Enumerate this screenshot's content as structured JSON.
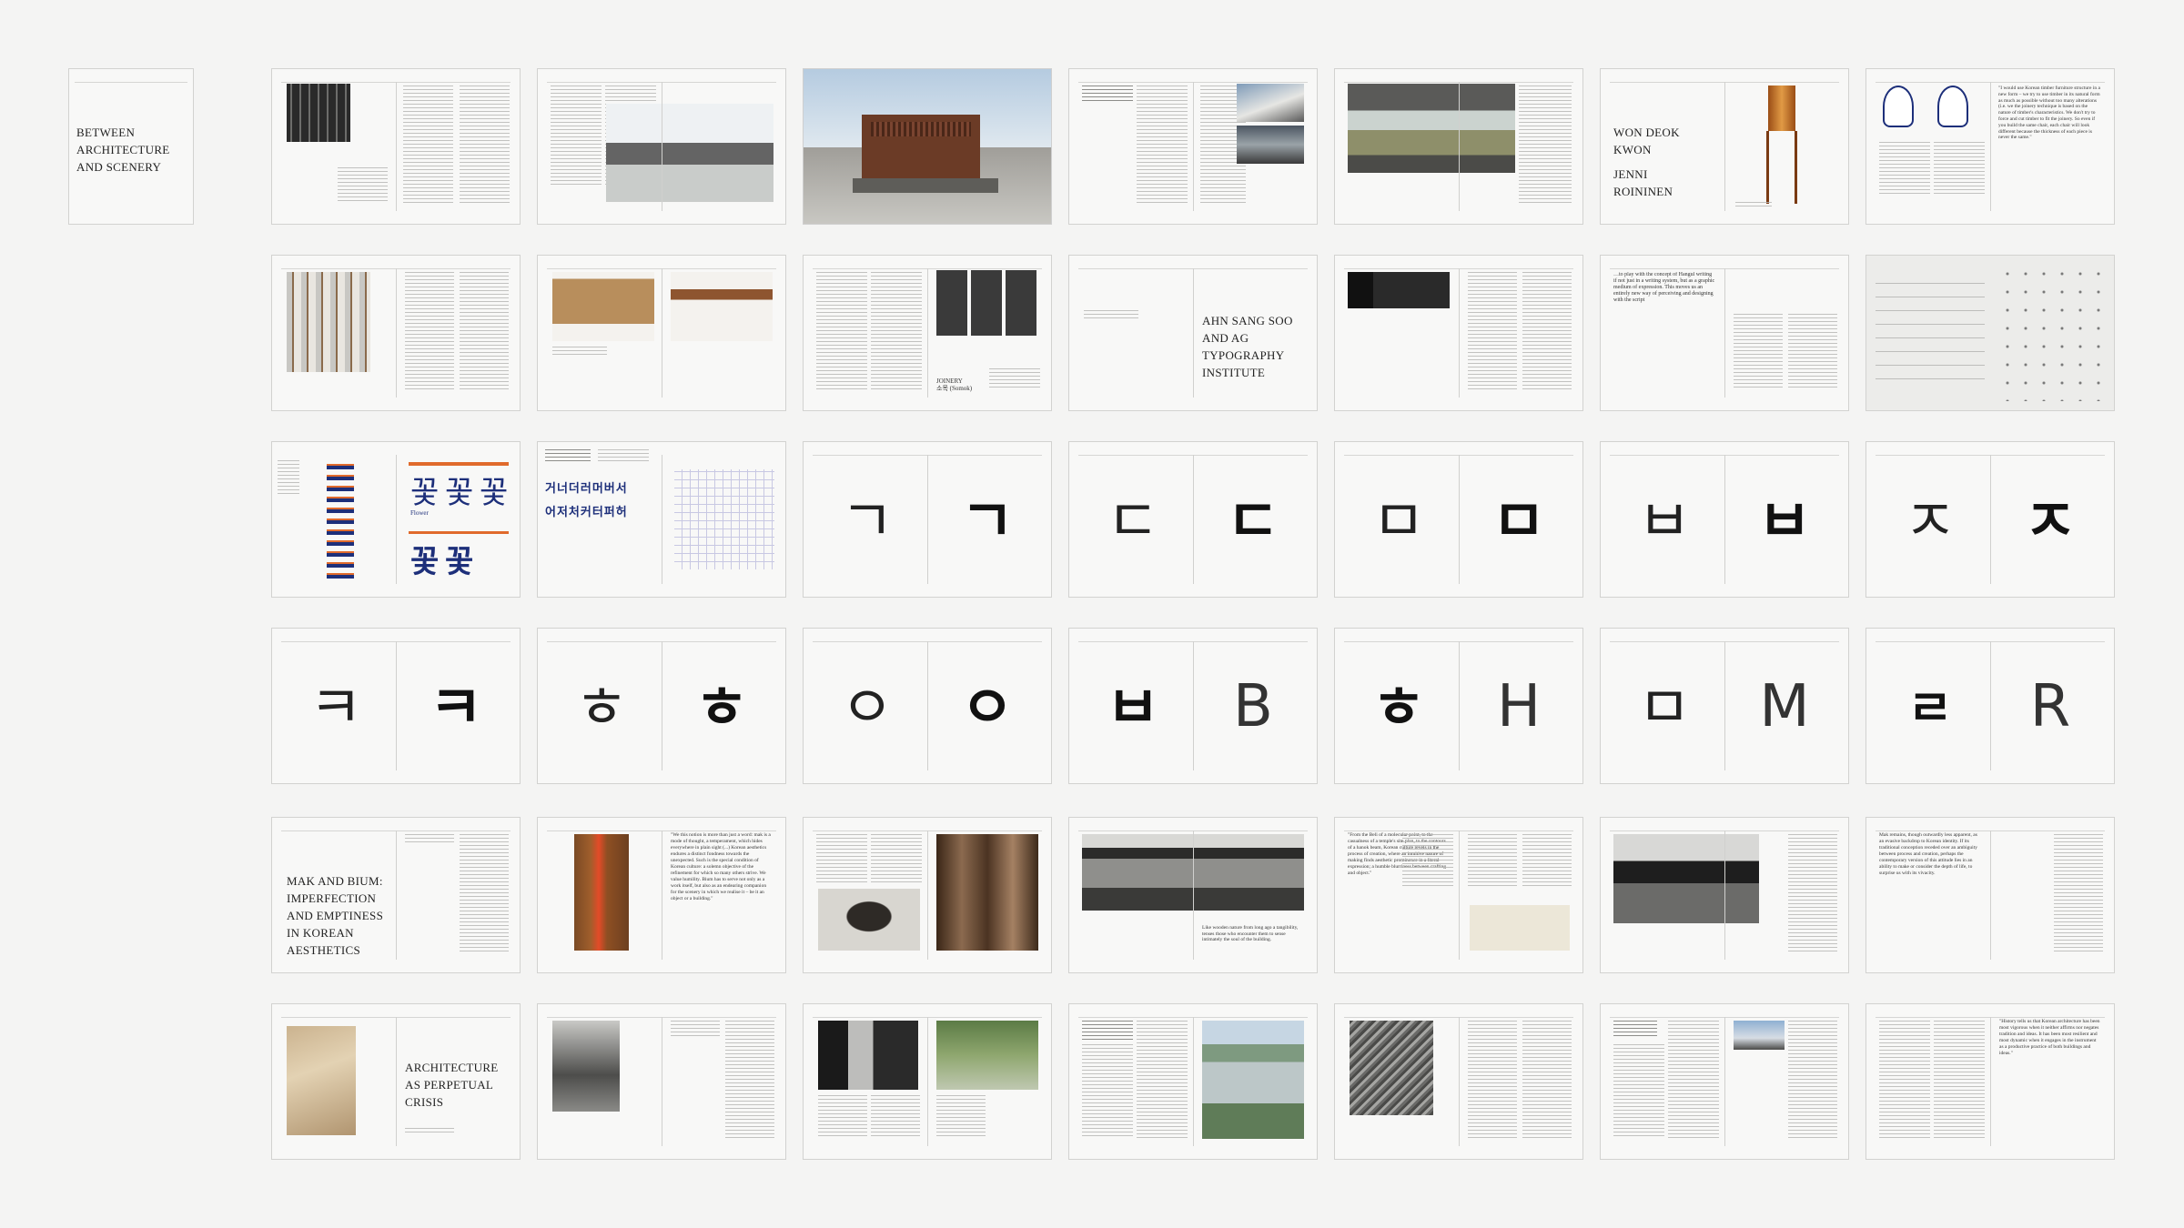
{
  "cover": {
    "title_lines": [
      "BETWEEN",
      "ARCHITECTURE",
      "AND SCENERY"
    ]
  },
  "spreads": {
    "won_deok": {
      "lines": [
        "WON DEOK",
        "KWON",
        "JENNI",
        "ROININEN"
      ]
    },
    "ahn_sang_soo": {
      "lines": [
        "AHN SANG SOO",
        "AND AG",
        "TYPOGRAPHY",
        "INSTITUTE"
      ]
    },
    "joinery": {
      "lines": [
        "JOINERY",
        "소목 (Somok)"
      ]
    },
    "mak_bium": {
      "lines": [
        "MAK AND BIUM:",
        "IMPERFECTION",
        "AND EMPTINESS",
        "IN KOREAN",
        "AESTHETICS"
      ]
    },
    "perpetual_crisis": {
      "lines": [
        "ARCHITECTURE",
        "AS PERPETUAL",
        "CRISIS"
      ]
    },
    "quote_lumber": {
      "text": "\"I would use Korean timber furniture structure in a new form – we try to use timber in its natural form as much as possible without too many alterations (i.e. we the joinery technique is based on the nature of timber's characteristics. We don't try to force and cut timber to fit the joinery. So even if you build the same chair, each chair will look different because the thickness of each piece is never the same.\""
    },
    "quote_hangul": {
      "text": "…to play with the concept of Hangul writing if not just in a writing system, but as a graphic medium of expression. This moves us an entirely new way of perceiving and designing with the script"
    },
    "quote_mak": {
      "text": "\"We this notion is more than just a word: mak is a mode of thought, a temperament, which hides everywhere in plain sight (...) Korean aesthetics endures a distinct fondness towards the unexpected. Such is the special condition of Korean culture: a solemn objective of the refinement for which so many others strive. We value humility. Bium has to serve not only as a work itself, but also as an endearing companion for the scenery in which we realise it – be it an object or a building.\""
    },
    "quote_nature": {
      "text": "Like wooden nature from long ago a tangibility, tenses those who encounter them to sense intimately the soul of the building."
    },
    "quote_molecular": {
      "text": "\"From the Beli of a molecular point, to the casualness of a temple's site plan, to the contours of a hanok beam, Korean culture revels in the process of creation, where an intuitive nature of making finds aesthetic prominence in a literal expression; a humble blurriness between crafting and object.\""
    },
    "quote_mak2": {
      "text": "Mak remains, though outwardly less apparent, as an evasive backdrop to Korean identity. If its traditional conception receded over an ambiguity between process and creation, perhaps the contemporary version of this attitude lies in an ability to make or consider the depth of life, to surprise us with its vivacity."
    },
    "quote_history": {
      "text": "\"History tells us that Korean architecture has been most vigorous when it neither affirms nor negates tradition and ideas. It has been most resilient and most dynamic when it engages in the instrument as a productive practice of both buildings and ideas.\""
    }
  },
  "glyph_pairs": [
    {
      "light": "ㄱ",
      "bold": "ㄱ"
    },
    {
      "light": "ㄷ",
      "bold": "ㄷ"
    },
    {
      "light": "ㅁ",
      "bold": "ㅁ"
    },
    {
      "light": "ㅂ",
      "bold": "ㅂ"
    },
    {
      "light": "ㅈ",
      "bold": "ㅈ"
    },
    {
      "light": "ㅋ",
      "bold": "ㅋ"
    },
    {
      "light": "ㅎ",
      "bold": "ㅎ"
    },
    {
      "light": "ㅇ",
      "bold": "ㅇ"
    },
    {
      "left": "ㅂ",
      "right": "B"
    },
    {
      "left": "ㅎ",
      "right": "H"
    },
    {
      "left": "ㅁ",
      "right": "M"
    },
    {
      "left": "ㄹ",
      "right": "R"
    }
  ],
  "hangul_sample": {
    "rows": [
      "거너더러머버서",
      "어저처커터퍼허"
    ],
    "flower": [
      "꽃",
      "꽃",
      "꽃"
    ],
    "flower_label": "Flower"
  },
  "colors": {
    "background": "#f4f4f3",
    "page": "#f8f8f7",
    "border": "#d2d2d0",
    "accent_orange": "#e06a2c",
    "accent_navy": "#1d2f7a"
  }
}
